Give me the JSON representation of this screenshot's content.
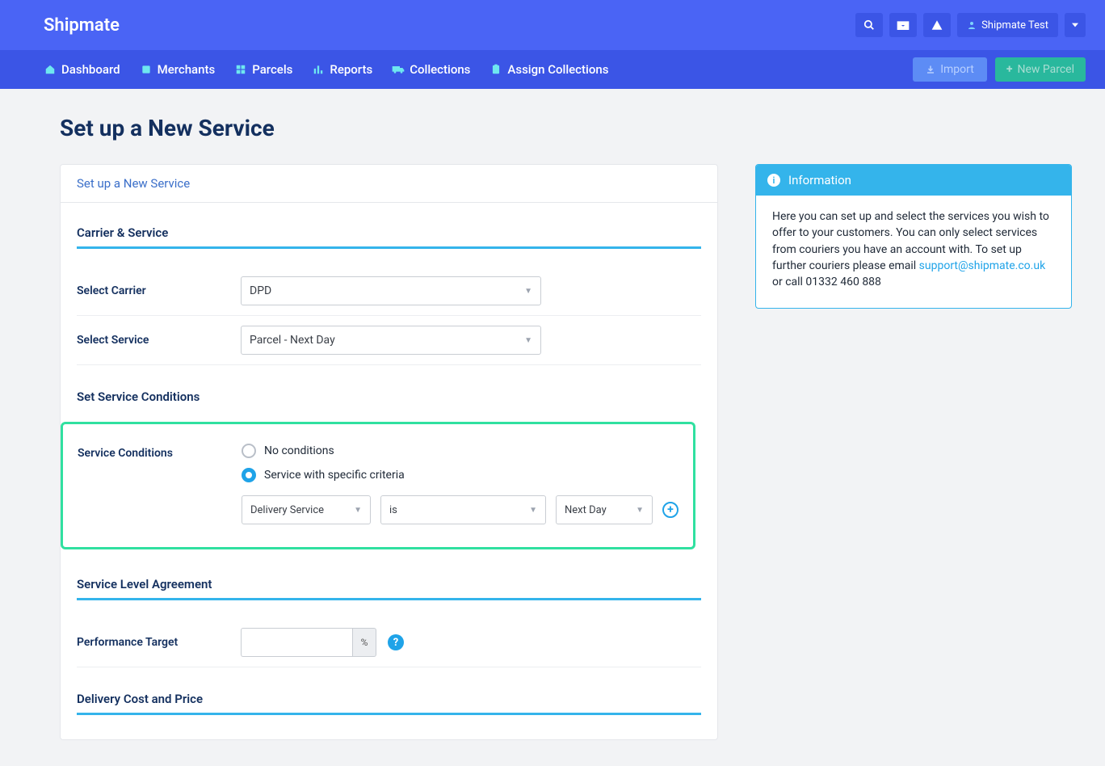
{
  "brand": "Shipmate",
  "topbar": {
    "user_label": "Shipmate Test"
  },
  "nav": {
    "items": [
      {
        "label": "Dashboard"
      },
      {
        "label": "Merchants"
      },
      {
        "label": "Parcels"
      },
      {
        "label": "Reports"
      },
      {
        "label": "Collections"
      },
      {
        "label": "Assign Collections"
      }
    ],
    "import_label": "Import",
    "new_parcel_label": "New Parcel"
  },
  "page": {
    "title": "Set up a New Service",
    "panel_head": "Set up a New Service"
  },
  "sections": {
    "carrier_service": "Carrier & Service",
    "set_conditions": "Set Service Conditions",
    "sla": "Service Level Agreement",
    "delivery_cost": "Delivery Cost and Price"
  },
  "form": {
    "select_carrier_label": "Select Carrier",
    "select_carrier_value": "DPD",
    "select_service_label": "Select Service",
    "select_service_value": "Parcel - Next Day",
    "service_conditions_label": "Service Conditions",
    "radio_none_label": "No conditions",
    "radio_specific_label": "Service with specific criteria",
    "criteria_field": "Delivery Service",
    "criteria_op": "is",
    "criteria_value": "Next Day",
    "perf_target_label": "Performance Target",
    "perf_unit": "%"
  },
  "info": {
    "title": "Information",
    "text1": "Here you can set up and select the services you wish to offer to your customers. You can only select services from couriers you have an account with. To set up further couriers please email ",
    "email": "support@shipmate.co.uk",
    "text2": " or call 01332 460 888"
  }
}
